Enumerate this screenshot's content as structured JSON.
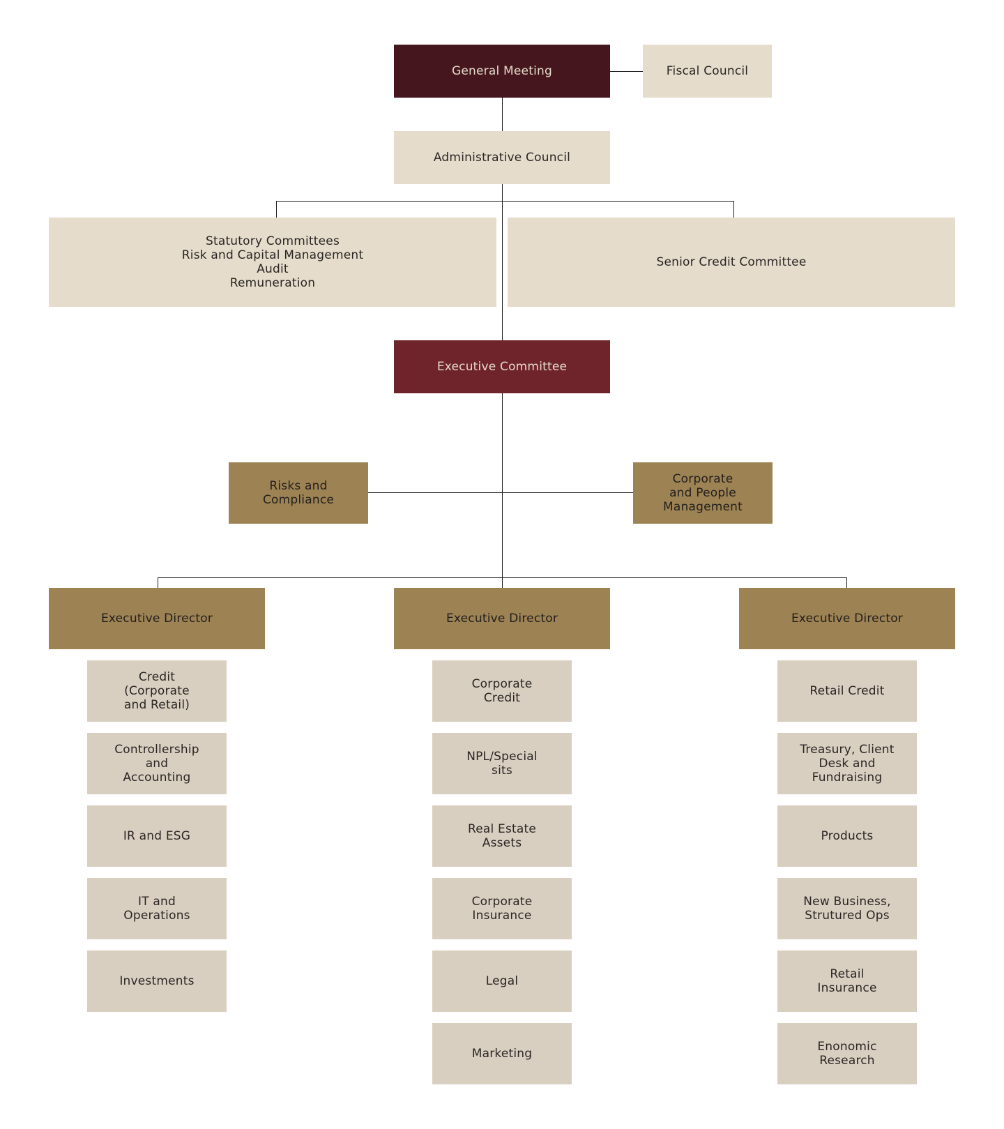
{
  "chart": {
    "top": {
      "general_meeting": "General Meeting",
      "fiscal_council": "Fiscal Council",
      "administrative_council": "Administrative Council"
    },
    "committees": {
      "statutory": "Statutory Committees\nRisk and Capital Management\nAudit\nRemuneration",
      "senior_credit": "Senior Credit Committee"
    },
    "executive_committee": "Executive Committee",
    "staff": {
      "risks": "Risks and\nCompliance",
      "corporate_people": "Corporate\nand People\nManagement"
    },
    "directors": [
      {
        "label": "Executive Director",
        "units": [
          "Credit\n(Corporate\nand Retail)",
          "Controllership\nand\nAccounting",
          "IR and ESG",
          "IT and\nOperations",
          "Investments"
        ]
      },
      {
        "label": "Executive Director",
        "units": [
          "Corporate\nCredit",
          "NPL/Special\nsits",
          "Real Estate\nAssets",
          "Corporate\nInsurance",
          "Legal",
          "Marketing"
        ]
      },
      {
        "label": "Executive Director",
        "units": [
          "Retail Credit",
          "Treasury, Client\nDesk and\nFundraising",
          "Products",
          "New Business,\nStrutured Ops",
          "Retail\nInsurance",
          "Enonomic\nResearch"
        ]
      }
    ]
  },
  "colors": {
    "general_meeting": "#45161d",
    "executive_committee": "#6f242c",
    "council_fill": "#e5dccb",
    "director_fill": "#9d8254",
    "unit_fill": "#d9cfc1",
    "connector": "#1d1d1d"
  }
}
